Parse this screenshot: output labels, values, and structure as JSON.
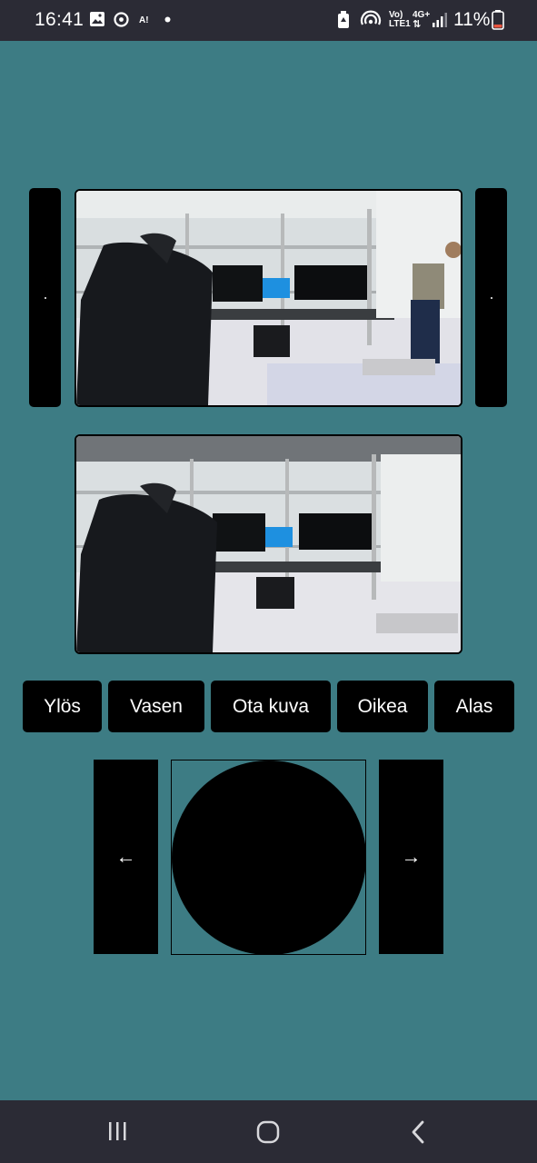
{
  "status_bar": {
    "time": "16:41",
    "battery": "11%",
    "network_label_top": "Vo)",
    "network_label_bottom": "LTE1",
    "network_4g": "4G+",
    "icons": [
      "gallery-icon",
      "sync-icon",
      "ai-icon",
      "dot-icon",
      "battery-saver-icon",
      "hotspot-icon",
      "signal-icon",
      "battery-icon"
    ]
  },
  "camera": {
    "top_feed": "camera-feed-1",
    "bottom_feed": "camera-feed-2"
  },
  "controls": {
    "buttons": {
      "up": "Ylös",
      "left": "Vasen",
      "capture": "Ota kuva",
      "right": "Oikea",
      "down": "Alas"
    },
    "joystick": {
      "left_arrow": "←",
      "right_arrow": "→"
    }
  },
  "navigation": {
    "icons": [
      "recent-apps-icon",
      "home-icon",
      "back-icon"
    ]
  },
  "colors": {
    "background": "#3d7c84",
    "bars": "#2b2b35",
    "controls": "#000000"
  }
}
